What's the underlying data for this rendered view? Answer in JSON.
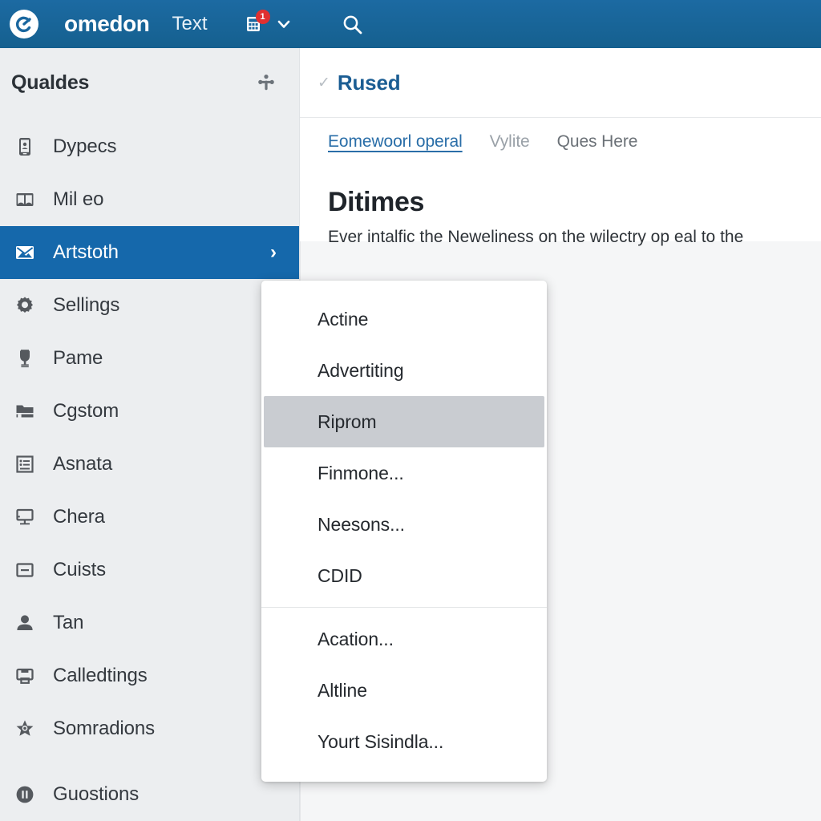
{
  "topbar": {
    "logo_icon": "circle-c-logo-icon",
    "brand": "omedon",
    "nav_text": "Text",
    "notification_icon": "calculator-icon",
    "notification_count": "1",
    "caret_icon": "chevron-down-icon",
    "search_icon": "search-icon",
    "background_color": "#1a679f"
  },
  "sidebar": {
    "title": "Qualdes",
    "header_icon": "share-nodes-icon",
    "active_color": "#1568ab",
    "background_color": "#eceef0",
    "items": [
      {
        "label": "Dypecs",
        "icon": "mobile-device-icon",
        "active": false
      },
      {
        "label": "Mil eo",
        "icon": "open-book-icon",
        "active": false
      },
      {
        "label": "Artstoth",
        "icon": "image-envelope-icon",
        "active": true,
        "chevron": "›"
      },
      {
        "label": "Sellings",
        "icon": "gear-icon",
        "active": false
      },
      {
        "label": "Pame",
        "icon": "trophy-icon",
        "active": false
      },
      {
        "label": "Cgstom",
        "icon": "folder-icon",
        "active": false
      },
      {
        "label": "Asnata",
        "icon": "list-document-icon",
        "active": false
      },
      {
        "label": "Chera",
        "icon": "monitor-icon",
        "active": false
      },
      {
        "label": "Cuists",
        "icon": "minus-square-icon",
        "active": false
      },
      {
        "label": "Tan",
        "icon": "user-icon",
        "active": false
      },
      {
        "label": "Calledtings",
        "icon": "printer-icon",
        "active": false
      },
      {
        "label": "Somradions",
        "icon": "star-badge-icon",
        "active": false
      },
      {
        "label": "Guostions",
        "icon": "info-circle-icon",
        "active": false
      }
    ]
  },
  "content": {
    "status_check_icon": "check-icon",
    "status_title": "Rused",
    "status_title_color": "#1b5d93",
    "tabs": [
      {
        "label": "Eomewoorl operal",
        "state": "active"
      },
      {
        "label": "Vylite",
        "state": "muted"
      },
      {
        "label": "Ques Here",
        "state": "normal"
      }
    ],
    "heading": "Ditimes",
    "paragraph": "Ever intalfic the Neweliness on the wilectry op eal to the"
  },
  "menu": {
    "highlight_color": "#c9ccd1",
    "groups": [
      {
        "items": [
          {
            "label": "Actine",
            "highlight": false
          },
          {
            "label": "Advertiting",
            "highlight": false
          },
          {
            "label": "Riprom",
            "highlight": true
          },
          {
            "label": "Finmone...",
            "highlight": false
          },
          {
            "label": "Neesons...",
            "highlight": false
          },
          {
            "label": "CDID",
            "highlight": false
          }
        ]
      },
      {
        "items": [
          {
            "label": "Acation...",
            "highlight": false
          },
          {
            "label": "Altline",
            "highlight": false
          },
          {
            "label": "Yourt Sisindla...",
            "highlight": false
          }
        ]
      }
    ]
  }
}
